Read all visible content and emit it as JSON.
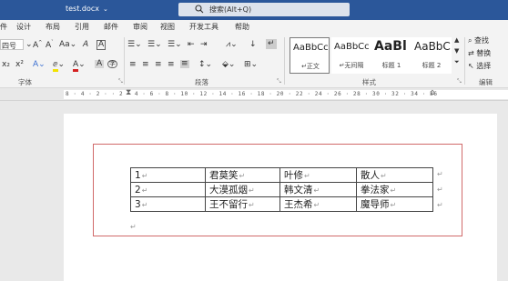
{
  "titlebar": {
    "doc_title": "test.docx",
    "search_label": "搜索(Alt+Q)"
  },
  "menu": {
    "tabs": [
      "件",
      "设计",
      "布局",
      "引用",
      "邮件",
      "审阅",
      "视图",
      "开发工具",
      "帮助"
    ]
  },
  "ribbon": {
    "font_name": "四号",
    "grow_font": "A^",
    "shrink_font": "A˅",
    "change_case": "Aa",
    "clear_format": "Ꭿ",
    "char_border": "A",
    "subscript": "x₂",
    "superscript": "x²",
    "text_effect": "A",
    "highlight": "ab",
    "font_color": "A",
    "char_shading": "A",
    "enclose_char": "字",
    "group_font": "字体",
    "group_paragraph": "段落",
    "group_styles": "样式",
    "group_editing": "编辑",
    "styles": [
      {
        "sample": "AaBbCc",
        "name": "↵正文",
        "selected": true
      },
      {
        "sample": "AaBbCc",
        "name": "↵无间隔",
        "selected": false
      },
      {
        "sample": "AaBl",
        "name": "标题 1",
        "selected": false
      },
      {
        "sample": "AaBbC",
        "name": "标题 2",
        "selected": false
      }
    ],
    "edit_find": "查找",
    "edit_replace": "替换",
    "edit_select": "选择"
  },
  "ruler": {
    "numbers": "8 · 4 · 2 ·  ·  2 · 4 · 6 · 8 · 10 · 12 · 14 · 16 · 18 · 20 · 22 · 24 · 26 · 28 · 30 · 32 · 34 · 36"
  },
  "table": {
    "rows": [
      [
        "1",
        "君莫笑",
        "叶修",
        "散人"
      ],
      [
        "2",
        "大漠孤烟",
        "韩文清",
        "拳法家"
      ],
      [
        "3",
        "王不留行",
        "王杰希",
        "魔导师"
      ]
    ]
  }
}
